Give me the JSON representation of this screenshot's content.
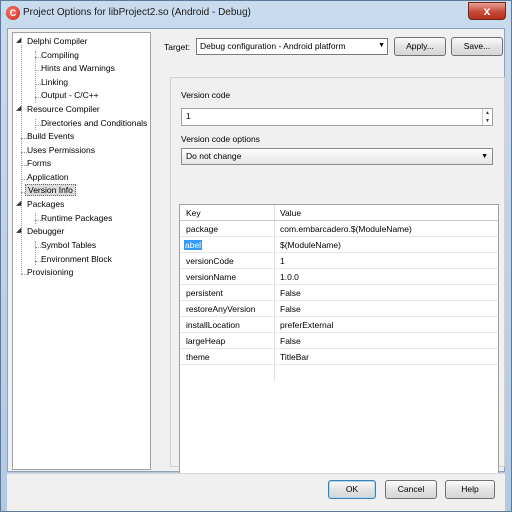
{
  "window": {
    "title": "Project Options for libProject2.so  (Android - Debug)",
    "close_label": "x"
  },
  "tree": {
    "items": [
      {
        "label": "Delphi Compiler",
        "expanded": true
      },
      {
        "label": "Compiling"
      },
      {
        "label": "Hints and Warnings"
      },
      {
        "label": "Linking"
      },
      {
        "label": "Output - C/C++"
      },
      {
        "label": "Resource Compiler",
        "expanded": true
      },
      {
        "label": "Directories and Conditionals"
      },
      {
        "label": "Build Events"
      },
      {
        "label": "Uses Permissions"
      },
      {
        "label": "Forms"
      },
      {
        "label": "Application"
      },
      {
        "label": "Version Info",
        "selected": true
      },
      {
        "label": "Packages",
        "expanded": true
      },
      {
        "label": "Runtime Packages"
      },
      {
        "label": "Debugger",
        "expanded": true
      },
      {
        "label": "Symbol Tables"
      },
      {
        "label": "Environment Block"
      },
      {
        "label": "Provisioning"
      }
    ]
  },
  "target": {
    "label": "Target:",
    "value": "Debug configuration - Android platform",
    "apply_label": "Apply...",
    "save_label": "Save..."
  },
  "version": {
    "code_label": "Version code",
    "code_value": "1",
    "options_label": "Version code options",
    "options_value": "Do not change"
  },
  "grid": {
    "headers": {
      "key": "Key",
      "value": "Value"
    },
    "rows": [
      {
        "key": "package",
        "value": "com.embarcadero.$(ModuleName)"
      },
      {
        "key": "abel",
        "value": "$(ModuleName)",
        "selected": true
      },
      {
        "key": "versionCode",
        "value": "1"
      },
      {
        "key": "versionName",
        "value": "1.0.0"
      },
      {
        "key": "persistent",
        "value": "False"
      },
      {
        "key": "restoreAnyVersion",
        "value": "False"
      },
      {
        "key": "installLocation",
        "value": "preferExternal"
      },
      {
        "key": "largeHeap",
        "value": "False"
      },
      {
        "key": "theme",
        "value": "TitleBar"
      }
    ]
  },
  "buttons": {
    "ok": "OK",
    "cancel": "Cancel",
    "help": "Help"
  },
  "colors": {
    "selection": "#3399ff",
    "close_button": "#c74a37"
  }
}
